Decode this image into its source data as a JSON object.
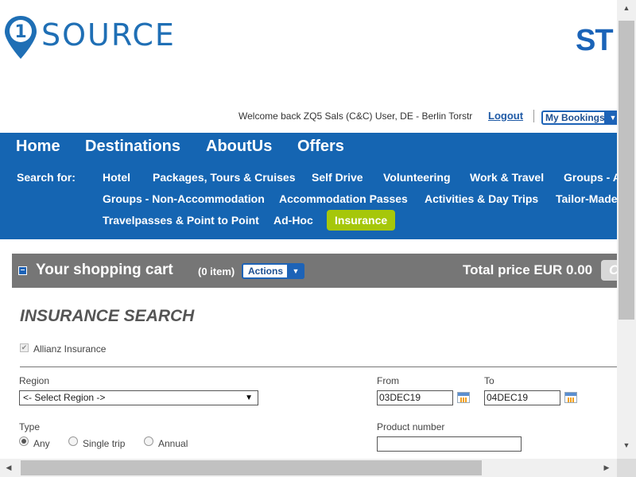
{
  "header": {
    "logo_text": "SOURCE",
    "partner_logo": "ST",
    "welcome": "Welcome back ZQ5 Sals (C&C) User, DE - Berlin Torstr",
    "logout": "Logout",
    "my_bookings": "My Bookings"
  },
  "main_nav": [
    "Home",
    "Destinations",
    "AboutUs",
    "Offers"
  ],
  "search_for_label": "Search for:",
  "sub_nav": {
    "row1": [
      "Hotel",
      "Packages, Tours & Cruises",
      "Self Drive",
      "Volunteering",
      "Work & Travel",
      "Groups - A"
    ],
    "row2": [
      "Groups - Non-Accommodation",
      "Accommodation Passes",
      "Activities & Day Trips",
      "Tailor-Made"
    ],
    "row3": [
      "Travelpasses & Point to Point",
      "Ad-Hoc",
      "Insurance"
    ]
  },
  "cart": {
    "title": "Your shopping cart",
    "count": "(0 item)",
    "actions": "Actions",
    "total": "Total price EUR 0.00",
    "right_button": "C"
  },
  "insurance": {
    "title": "INSURANCE SEARCH",
    "provider_label": "Allianz Insurance",
    "provider_checked": true,
    "region_label": "Region",
    "region_value": "<- Select Region ->",
    "from_label": "From",
    "from_value": "03DEC19",
    "to_label": "To",
    "to_value": "04DEC19",
    "type_label": "Type",
    "type_options": [
      "Any",
      "Single trip",
      "Annual"
    ],
    "type_selected": "Any",
    "product_number_label": "Product number",
    "product_number_value": ""
  },
  "colors": {
    "brand_blue": "#1565b2",
    "active_green": "#a6c70a",
    "cart_gray": "#767676"
  }
}
